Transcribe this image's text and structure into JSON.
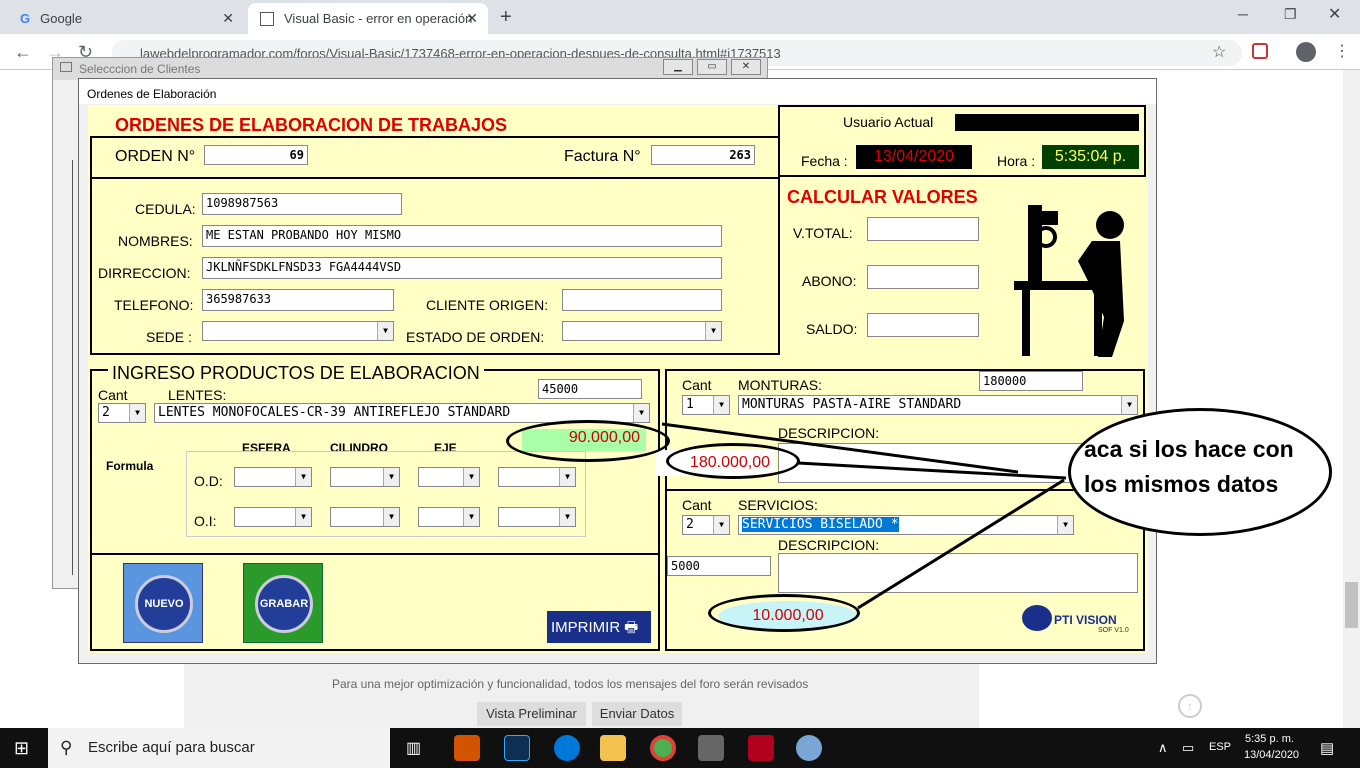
{
  "browser": {
    "tabs": [
      {
        "label": "Google"
      },
      {
        "label": "Visual Basic - error en operación"
      }
    ],
    "url": "lawebdelprogramador.com/foros/Visual-Basic/1737468-error-en-operacion-despues-de-consulta.html#i1737513"
  },
  "page": {
    "footer_note": "Para una mejor optimización y funcionalidad, todos los mensajes del foro serán revisados",
    "preview_button": "Vista Preliminar",
    "send_button": "Enviar Datos"
  },
  "window_clients": {
    "title": "Selecccion de Clientes"
  },
  "window_orders": {
    "title": "Ordenes de Elaboración",
    "header_title": "ORDENES DE  ELABORACION DE TRABAJOS",
    "orden_label": "ORDEN N°",
    "orden_value": "69",
    "factura_label": "Factura N°",
    "factura_value": "263",
    "usuario_label": "Usuario Actual",
    "fecha_label": "Fecha :",
    "fecha_value": "13/04/2020",
    "hora_label": "Hora :",
    "hora_value": "5:35:04 p.",
    "cedula_label": "CEDULA:",
    "cedula_value": "1098987563",
    "nombres_label": "NOMBRES:",
    "nombres_value": "ME ESTAN PROBANDO HOY MISMO",
    "direccion_label": "DIRRECCION:",
    "direccion_value": "JKLNÑFSDKLFNSD33 FGA4444VSD",
    "telefono_label": "TELEFONO:",
    "telefono_value": "365987633",
    "cliente_origen_label": "CLIENTE ORIGEN:",
    "sede_label": "SEDE :",
    "estado_label": "ESTADO DE ORDEN:",
    "calc_title": "CALCULAR VALORES",
    "vtotal_label": "V.TOTAL:",
    "abono_label": "ABONO:",
    "saldo_label": "SALDO:",
    "ingreso_title": "INGRESO PRODUCTOS DE ELABORACION",
    "cant_label": "Cant",
    "lentes_label": "LENTES:",
    "lentes_price": "45000",
    "lentes_cant": "2",
    "lentes_value": "LENTES  MONOFOCALES-CR-39  ANTIREFLEJO  STANDARD",
    "lentes_total": "90.000,00",
    "formula_label": "Formula",
    "esfera_label": "ESFERA",
    "cilindro_label": "CILINDRO",
    "eje_label": "EJE",
    "od_label": "O.D:",
    "oi_label": "O.I:",
    "monturas_label": "MONTURAS:",
    "monturas_price": "180000",
    "monturas_cant": "1",
    "monturas_value": "MONTURAS  PASTA-AIRE  STANDARD",
    "descripcion_label": "DESCRIPCION:",
    "monturas_total": "180.000,00",
    "servicios_label": "SERVICIOS:",
    "servicios_cant": "2",
    "servicios_value": "SERVICIOS  BISELADO  *",
    "servicios_price": "5000",
    "servicios_total": "10.000,00",
    "nuevo_button": "NUEVO",
    "grabar_button": "GRABAR",
    "imprimir_button": "IMPRIMIR",
    "logo_text": "PTI VISION",
    "logo_sub": "SOF  V1.0"
  },
  "annotation": {
    "text": "aca si los hace con los mismos datos"
  },
  "taskbar": {
    "search_placeholder": "Escribe aquí para buscar",
    "lang": "ESP",
    "time": "5:35 p. m.",
    "date": "13/04/2020"
  },
  "colors": {
    "form_bg": "#ffffc6",
    "title_red": "#e00000",
    "title_blue": "#0000c0",
    "fecha_bg": "#000000",
    "hora_bg": "#004000"
  }
}
